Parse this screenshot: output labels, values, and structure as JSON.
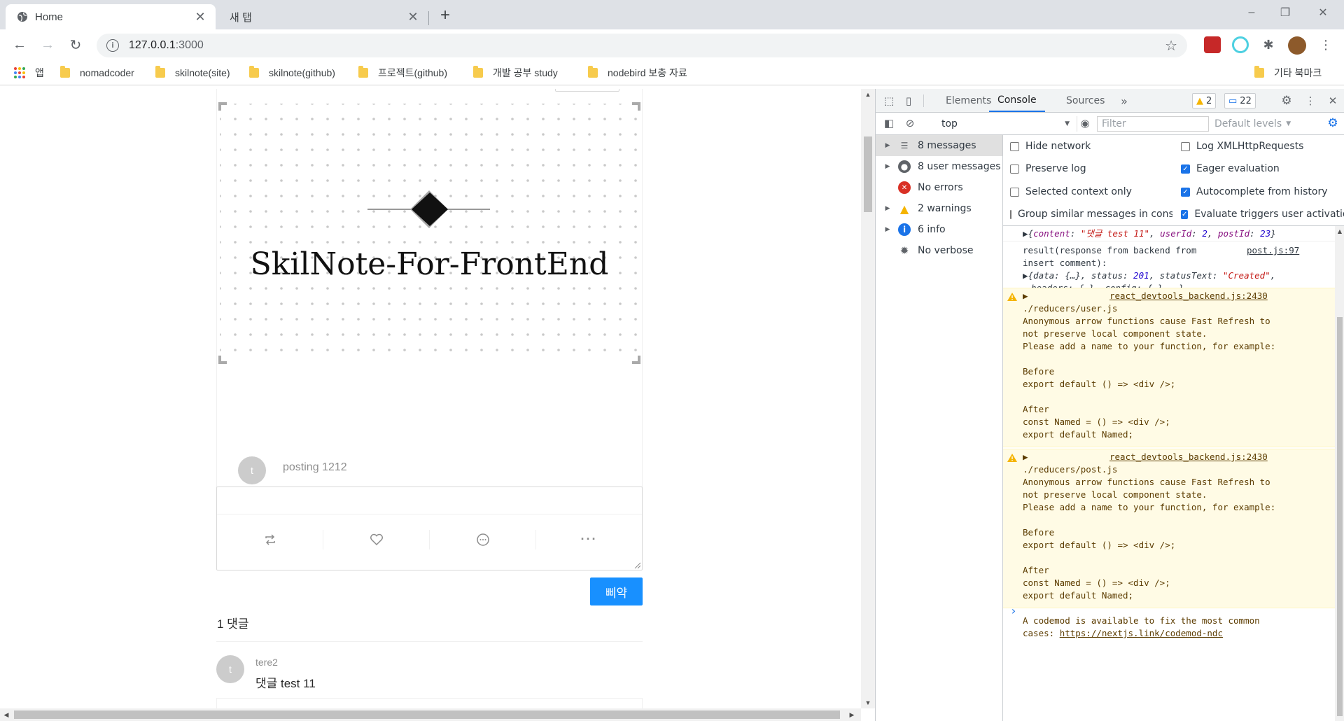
{
  "browser": {
    "tabs": [
      {
        "title": "Home",
        "active": true
      },
      {
        "title": "새 탭",
        "active": false
      }
    ],
    "url_host": "127.0.0.1",
    "url_port": ":3000",
    "bookmarks": [
      {
        "label": "앱",
        "icon": "apps-icon"
      },
      {
        "label": "nomadcoder",
        "icon": "folder-icon"
      },
      {
        "label": "skilnote(site)",
        "icon": "folder-icon"
      },
      {
        "label": "skilnote(github)",
        "icon": "folder-icon"
      },
      {
        "label": "프로젝트(github)",
        "icon": "folder-icon"
      },
      {
        "label": "개발 공부 study",
        "icon": "folder-icon"
      },
      {
        "label": "nodebird 보충 자료",
        "icon": "folder-icon"
      },
      {
        "label": "기타 북마크",
        "icon": "folder-icon"
      }
    ]
  },
  "page": {
    "cover_title": "SkilNote-For-FrontEnd",
    "post_avatar": "t",
    "post_text": "posting 1212",
    "comment_placeholder": "",
    "submit_label": "삐약",
    "comment_count": "1 댓글",
    "comments": [
      {
        "avatar": "t",
        "author": "tere2",
        "content": "댓글 test 11"
      }
    ]
  },
  "devtools": {
    "tabs": [
      "Elements",
      "Console",
      "Sources"
    ],
    "active_tab": "Console",
    "warning_badge": "2",
    "message_badge": "22",
    "context": "top",
    "filter_placeholder": "Filter",
    "levels": "Default levels",
    "sidebar": [
      {
        "label": "8 messages",
        "icon": "list-icon"
      },
      {
        "label": "8 user messages",
        "icon": "user-icon"
      },
      {
        "label": "No errors",
        "icon": "error-icon"
      },
      {
        "label": "2 warnings",
        "icon": "warning-icon"
      },
      {
        "label": "6 info",
        "icon": "info-icon"
      },
      {
        "label": "No verbose",
        "icon": "bug-icon"
      }
    ],
    "settings_left": [
      {
        "label": "Hide network",
        "checked": false
      },
      {
        "label": "Preserve log",
        "checked": false
      },
      {
        "label": "Selected context only",
        "checked": false
      },
      {
        "label": "Group similar messages in console",
        "checked": false
      }
    ],
    "settings_right": [
      {
        "label": "Log XMLHttpRequests",
        "checked": false
      },
      {
        "label": "Eager evaluation",
        "checked": true
      },
      {
        "label": "Autocomplete from history",
        "checked": true
      },
      {
        "label": "Evaluate triggers user activation",
        "checked": true
      }
    ],
    "console": {
      "obj1": {
        "content_key": "content",
        "content_val": "\"댓글 test 11\"",
        "userId_key": "userId",
        "userId_val": "2",
        "postId_key": "postId",
        "postId_val": "23"
      },
      "log2_line1": "result(response from backend from",
      "log2_line2": "insert comment):",
      "log2_src": "post.js:97",
      "log2_obj_a": "{data: {…}, status: ",
      "log2_status": "201",
      "log2_obj_b": ", statusText: ",
      "log2_statusText": "\"Created\"",
      "log2_obj_c": ",",
      "log2_obj_line2": "headers: {…}, config: {…}, …}",
      "warnings": [
        {
          "src": "react_devtools_backend.js:2430",
          "lines": [
            "./reducers/user.js",
            "Anonymous arrow functions cause Fast Refresh to",
            "not preserve local component state.",
            "Please add a name to your function, for example:",
            "",
            "Before",
            "export default () => <div />;",
            "",
            "After",
            "const Named = () => <div />;",
            "export default Named;",
            "",
            "A codemod is available to fix the most common"
          ],
          "last_prefix": "cases: ",
          "link": "https://nextjs.link/codemod-ndc"
        },
        {
          "src": "react_devtools_backend.js:2430",
          "lines": [
            "./reducers/post.js",
            "Anonymous arrow functions cause Fast Refresh to",
            "not preserve local component state.",
            "Please add a name to your function, for example:",
            "",
            "Before",
            "export default () => <div />;",
            "",
            "After",
            "const Named = () => <div />;",
            "export default Named;",
            "",
            "A codemod is available to fix the most common"
          ],
          "last_prefix": "cases: ",
          "link": "https://nextjs.link/codemod-ndc"
        }
      ]
    }
  },
  "colors": {
    "accent": "#1890ff",
    "devtools_accent": "#1a73e8",
    "warning_bg": "#fffbe5"
  }
}
